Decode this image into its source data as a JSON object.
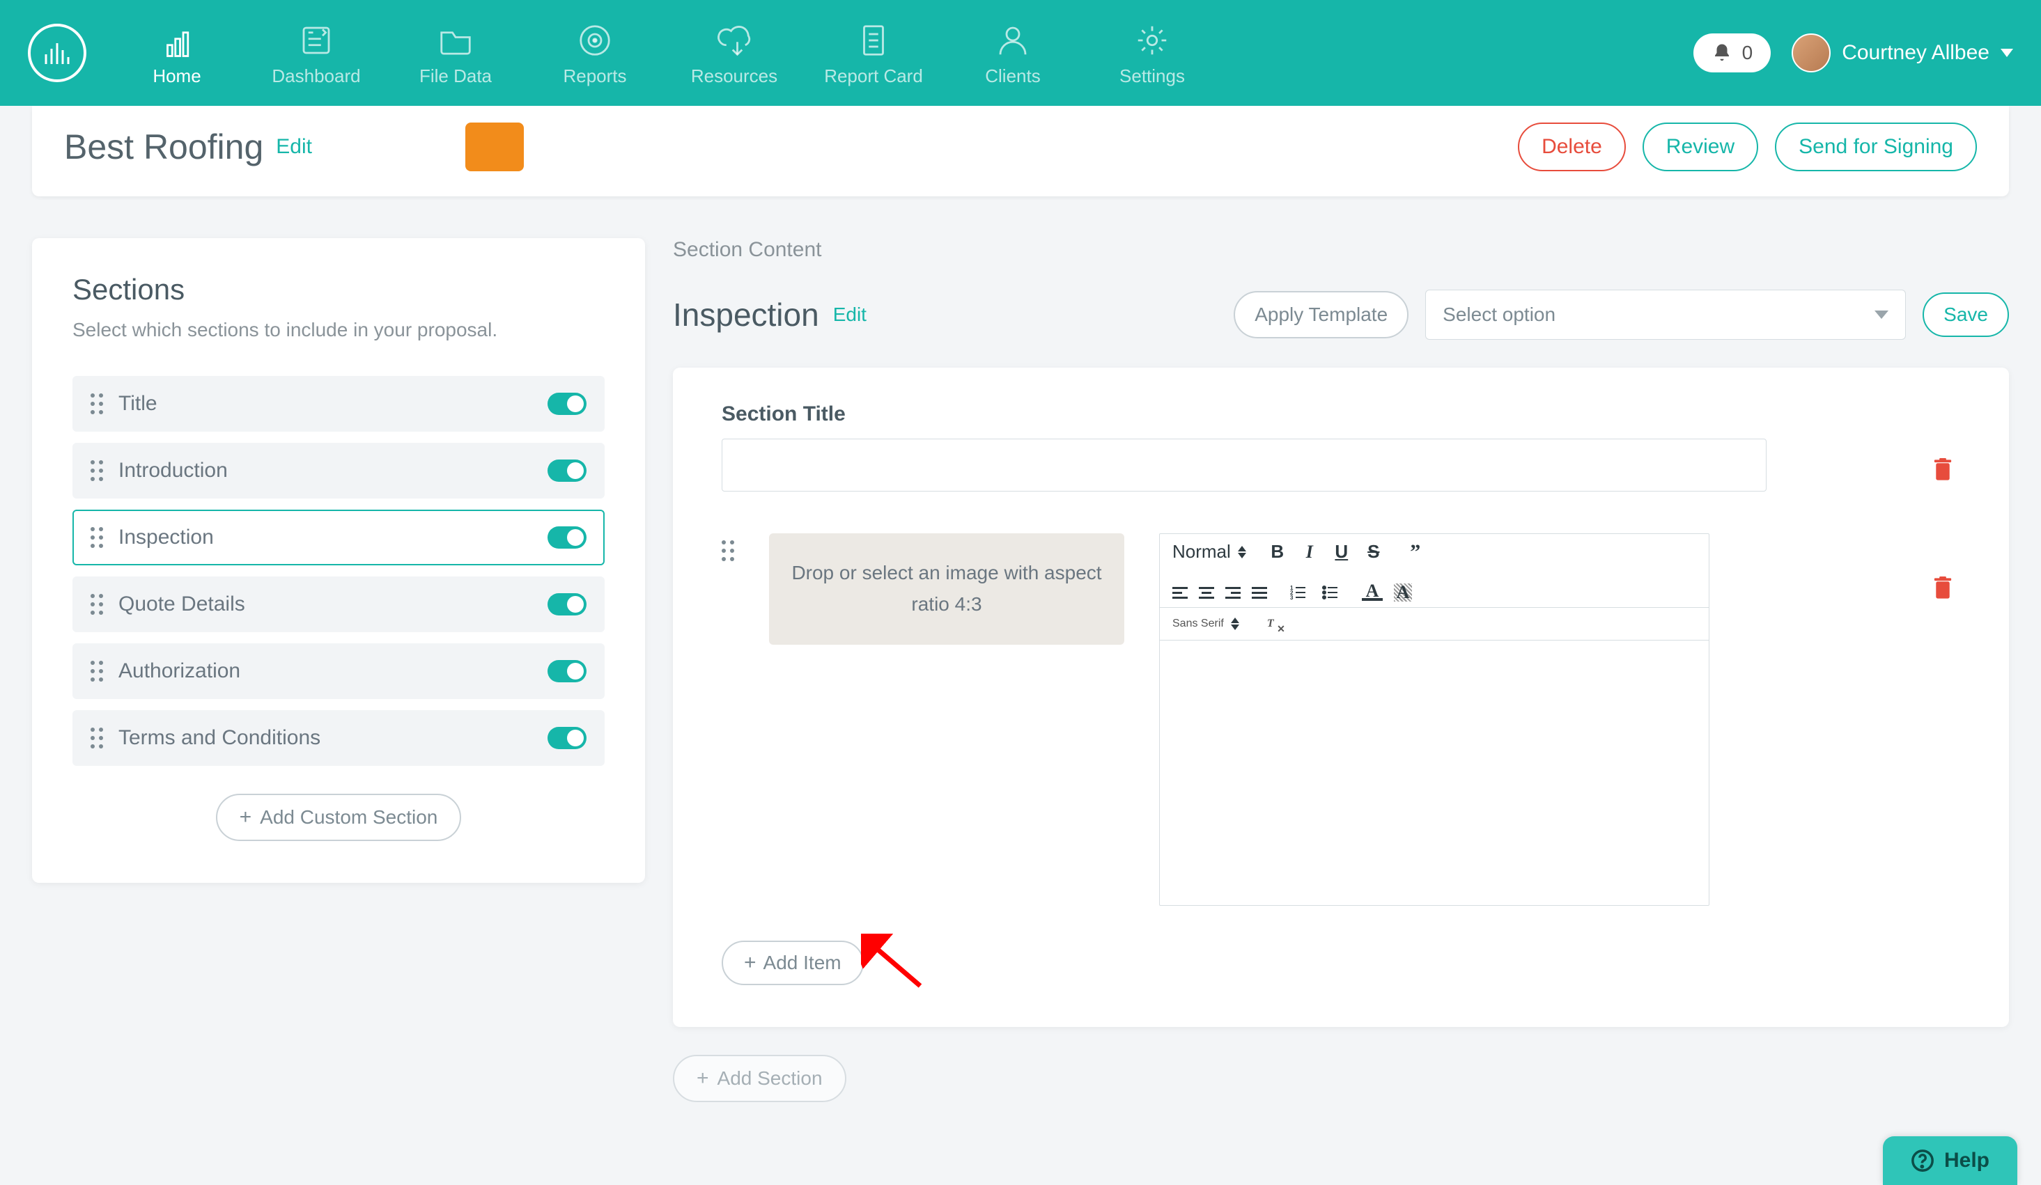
{
  "nav": {
    "items": [
      {
        "label": "Home"
      },
      {
        "label": "Dashboard"
      },
      {
        "label": "File Data"
      },
      {
        "label": "Reports"
      },
      {
        "label": "Resources"
      },
      {
        "label": "Report Card"
      },
      {
        "label": "Clients"
      },
      {
        "label": "Settings"
      }
    ],
    "notification_count": "0",
    "user_name": "Courtney Allbee"
  },
  "page": {
    "title": "Best Roofing",
    "edit_label": "Edit",
    "actions": {
      "delete": "Delete",
      "review": "Review",
      "send": "Send for Signing"
    }
  },
  "sections_panel": {
    "heading": "Sections",
    "subtitle": "Select which sections to include in your proposal.",
    "items": [
      {
        "label": "Title"
      },
      {
        "label": "Introduction"
      },
      {
        "label": "Inspection"
      },
      {
        "label": "Quote Details"
      },
      {
        "label": "Authorization"
      },
      {
        "label": "Terms and Conditions"
      }
    ],
    "add_label": "Add Custom Section"
  },
  "content": {
    "section_content_label": "Section Content",
    "title": "Inspection",
    "edit_label": "Edit",
    "apply_template_label": "Apply Template",
    "select_placeholder": "Select option",
    "save_label": "Save",
    "field_title_label": "Section Title",
    "image_drop_text": "Drop or select an image with aspect ratio 4:3",
    "editor_format": "Normal",
    "editor_font": "Sans Serif",
    "add_item_label": "Add Item",
    "add_section_label": "Add Section"
  },
  "help_label": "Help"
}
